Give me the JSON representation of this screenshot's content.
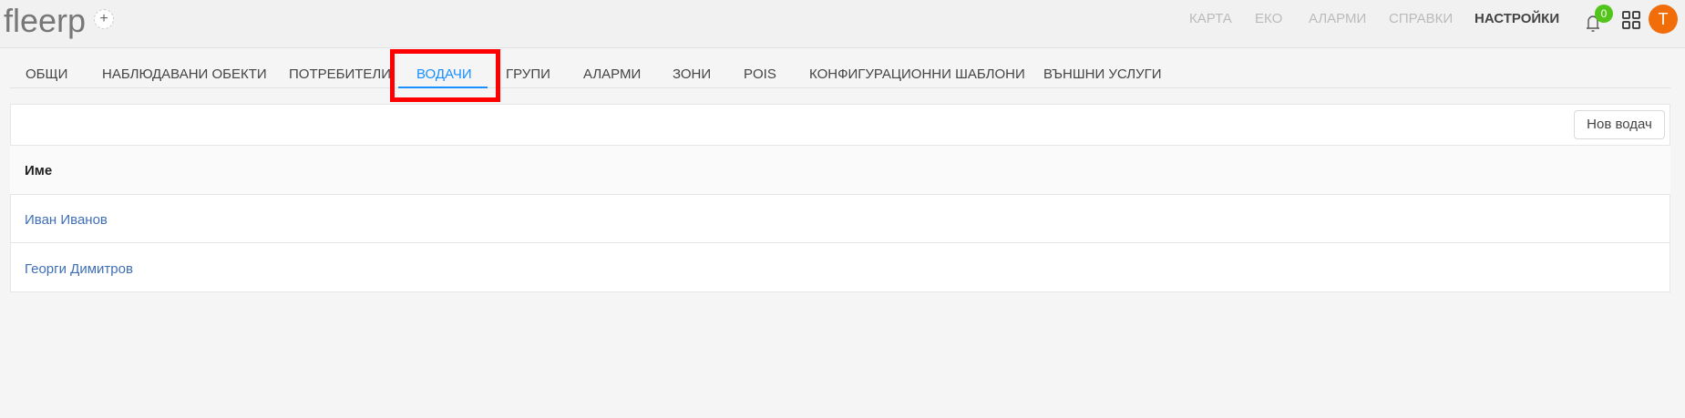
{
  "header": {
    "logo": "fleerp",
    "add_label": "+",
    "nav": [
      "КАРТА",
      "ЕКО",
      "АЛАРМИ",
      "СПРАВКИ",
      "НАСТРОЙКИ"
    ],
    "active_nav": "НАСТРОЙКИ",
    "notifications_count": "0",
    "avatar_initial": "T",
    "avatar_color": "#f06d0a"
  },
  "tabs": [
    "ОБЩИ",
    "НАБЛЮДАВАНИ ОБЕКТИ",
    "ПОТРЕБИТЕЛИ",
    "ВОДАЧИ",
    "ГРУПИ",
    "АЛАРМИ",
    "ЗОНИ",
    "POIS",
    "КОНФИГУРАЦИОННИ ШАБЛОНИ",
    "ВЪНШНИ УСЛУГИ"
  ],
  "active_tab": "ВОДАЧИ",
  "toolbar": {
    "new_driver": "Нов водач"
  },
  "table": {
    "columns": [
      "Име"
    ],
    "rows": [
      [
        "Иван Иванов"
      ],
      [
        "Георги Димитров"
      ]
    ]
  }
}
